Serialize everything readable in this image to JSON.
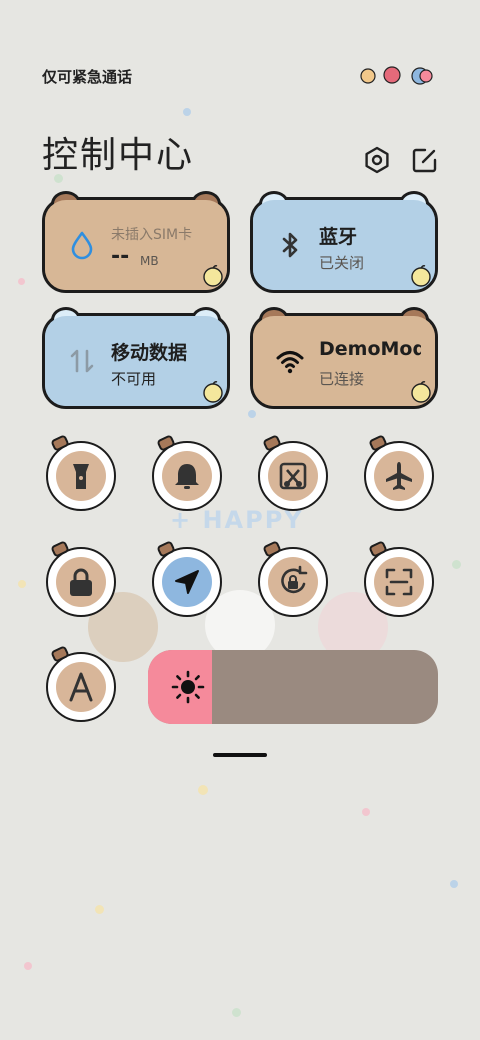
{
  "status": {
    "carrier": "仅可紧急通话"
  },
  "header": {
    "title": "控制中心",
    "settings_icon": "gear-icon",
    "edit_icon": "edit-icon"
  },
  "cards": [
    {
      "id": "mobile-data-usage",
      "title": "未插入SIM卡",
      "value": "--",
      "unit": "MB",
      "icon": "water-drop-icon",
      "style": "brown"
    },
    {
      "id": "bluetooth",
      "title": "蓝牙",
      "status": "已关闭",
      "icon": "bluetooth-icon",
      "style": "blue"
    },
    {
      "id": "mobile-data",
      "title": "移动数据",
      "status": "不可用",
      "icon": "data-transfer-icon",
      "style": "blue"
    },
    {
      "id": "wifi",
      "title": "DemoMod",
      "status": "已连接",
      "icon": "wifi-icon",
      "style": "brown"
    }
  ],
  "toggles": [
    {
      "name": "flashlight",
      "icon": "flashlight-icon",
      "active": false
    },
    {
      "name": "silent",
      "icon": "bell-icon",
      "active": false
    },
    {
      "name": "screenshot",
      "icon": "screenshot-icon",
      "active": false
    },
    {
      "name": "airplane-mode",
      "icon": "airplane-icon",
      "active": false
    },
    {
      "name": "lock-screen",
      "icon": "lock-icon",
      "active": false
    },
    {
      "name": "location",
      "icon": "location-arrow-icon",
      "active": true
    },
    {
      "name": "rotation-lock",
      "icon": "rotation-lock-icon",
      "active": false
    },
    {
      "name": "scanner",
      "icon": "scan-icon",
      "active": false
    },
    {
      "name": "font-size",
      "icon": "letter-a-icon",
      "active": false
    }
  ],
  "brightness": {
    "level": 0.22,
    "icon": "sun-icon"
  },
  "colors": {
    "brown_card": "#d7b796",
    "blue_card": "#b3d0e6",
    "toggle_disc": "#d8b699",
    "active_disc": "#8eb7df",
    "brightness_fill": "#f58a9b",
    "brightness_track": "#9a8a80"
  },
  "wallpaper": {
    "text": "+ HAPPY"
  }
}
